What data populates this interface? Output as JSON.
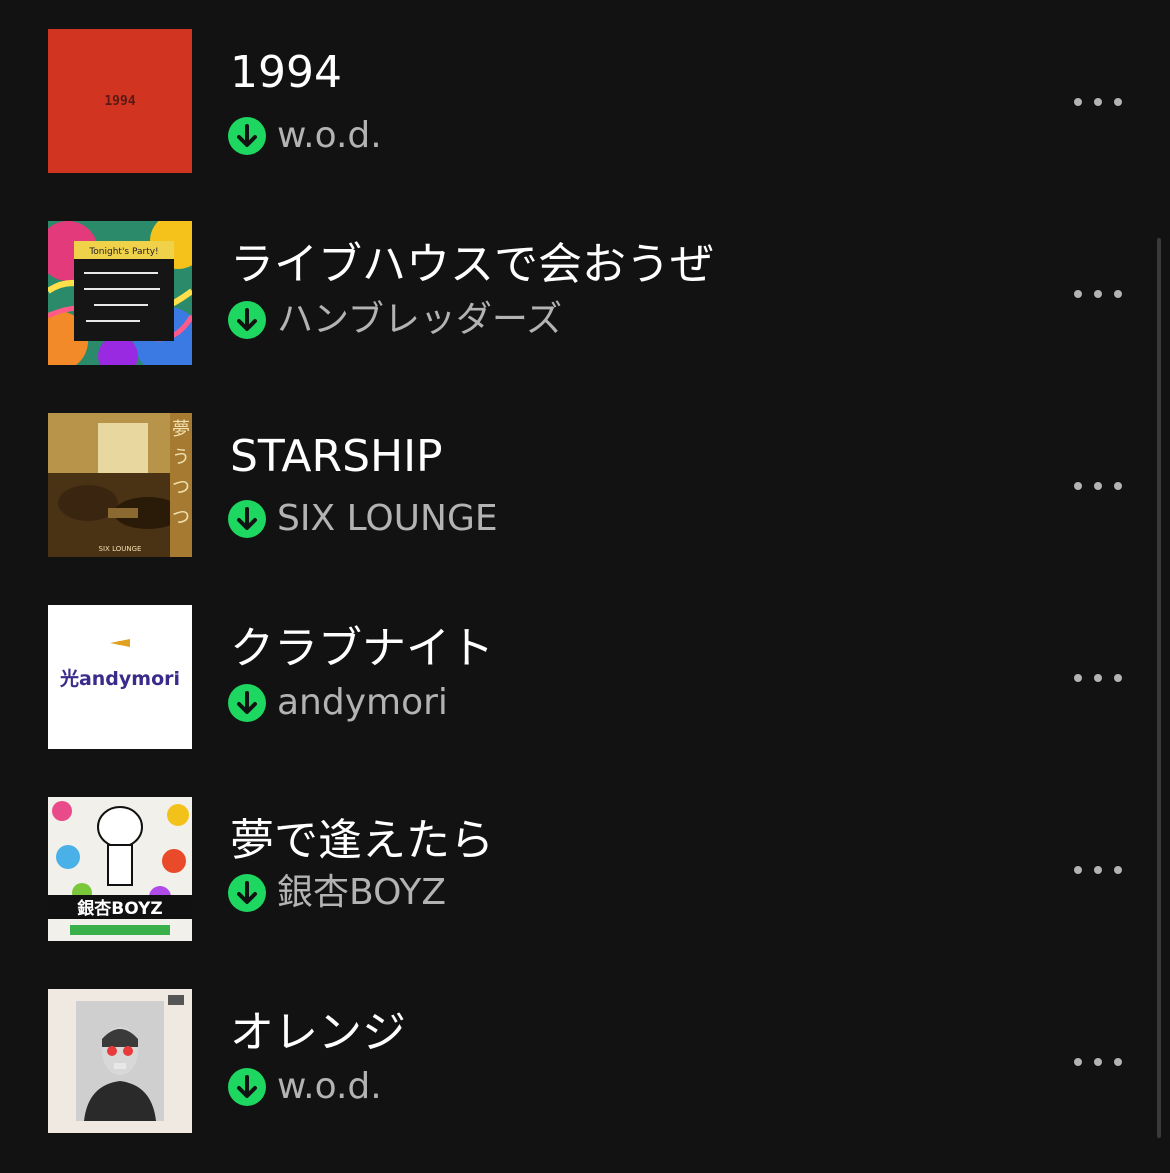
{
  "tracks": [
    {
      "title": "1994",
      "artist": "w.o.d.",
      "downloaded": true,
      "art_icon": "album-art-red",
      "art_text": "1994"
    },
    {
      "title": "ライブハウスで会おうぜ",
      "artist": "ハンブレッダーズ",
      "downloaded": true,
      "art_icon": "album-art-psychedelic",
      "art_text": "Tonight's Party!"
    },
    {
      "title": "STARSHIP",
      "artist": "SIX LOUNGE",
      "downloaded": true,
      "art_icon": "album-art-room-photo",
      "art_text": "SIX LOUNGE"
    },
    {
      "title": "クラブナイト",
      "artist": "andymori",
      "downloaded": true,
      "art_icon": "album-art-white-logo",
      "art_text": "光andymori"
    },
    {
      "title": "夢で逢えたら",
      "artist": "銀杏BOYZ",
      "downloaded": true,
      "art_icon": "album-art-collage",
      "art_text": "銀杏BOYZ"
    },
    {
      "title": "オレンジ",
      "artist": "w.o.d.",
      "downloaded": true,
      "art_icon": "album-art-portrait",
      "art_text": ""
    }
  ],
  "icons": {
    "download": "download-arrow-icon",
    "more": "more-options-icon"
  },
  "colors": {
    "background": "#121212",
    "title": "#ffffff",
    "artist": "#b3b3b3",
    "download_badge": "#1ed760"
  }
}
